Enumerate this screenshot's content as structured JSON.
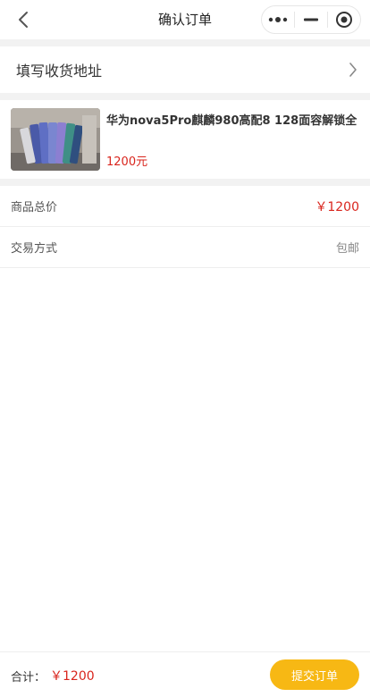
{
  "navbar": {
    "title": "确认订单",
    "back_icon": "chevron-left-icon",
    "capsule": {
      "more_icon": "more-dots-icon",
      "minimize_icon": "minimize-icon",
      "close_icon": "target-circle-icon"
    }
  },
  "address": {
    "label": "填写收货地址",
    "icon": "chevron-right-icon"
  },
  "product": {
    "title": "华为nova5Pro麒麟980高配8 128面容解锁全",
    "price": "1200元",
    "image_icon": "product-photo"
  },
  "summary": {
    "total_label": "商品总价",
    "total_value": "￥1200",
    "trade_label": "交易方式",
    "trade_value": "包邮"
  },
  "footer": {
    "sum_label": "合计：",
    "sum_value": "￥1200",
    "submit_label": "提交订单"
  },
  "colors": {
    "price_red": "#d9251d",
    "submit_yellow": "#f7b814",
    "background_gray": "#f2f2f2"
  }
}
